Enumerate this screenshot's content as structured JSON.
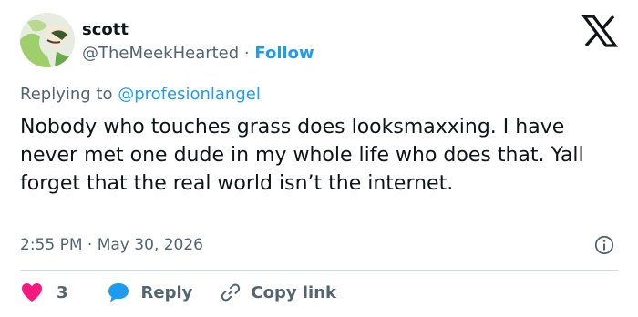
{
  "author": {
    "display_name": "scott",
    "handle": "@TheMeekHearted",
    "separator": "·",
    "follow_label": "Follow"
  },
  "reply_context": {
    "prefix": "Replying to",
    "mention": "@profesionlangel"
  },
  "tweet": {
    "text": "Nobody who touches grass does looksmaxxing. I have never met one dude in my whole life who does that. Yall forget that the real world isn’t the internet.",
    "time": "2:55 PM",
    "separator": "·",
    "date": "May 30, 2026"
  },
  "actions": {
    "like_count": "3",
    "reply_label": "Reply",
    "copy_link_label": "Copy link"
  },
  "colors": {
    "accent": "#1d9bf0",
    "like": "#f91880",
    "secondary_text": "#536471"
  },
  "icons": [
    "x-logo-icon",
    "info-icon",
    "heart-icon",
    "speech-bubble-icon",
    "link-icon"
  ]
}
